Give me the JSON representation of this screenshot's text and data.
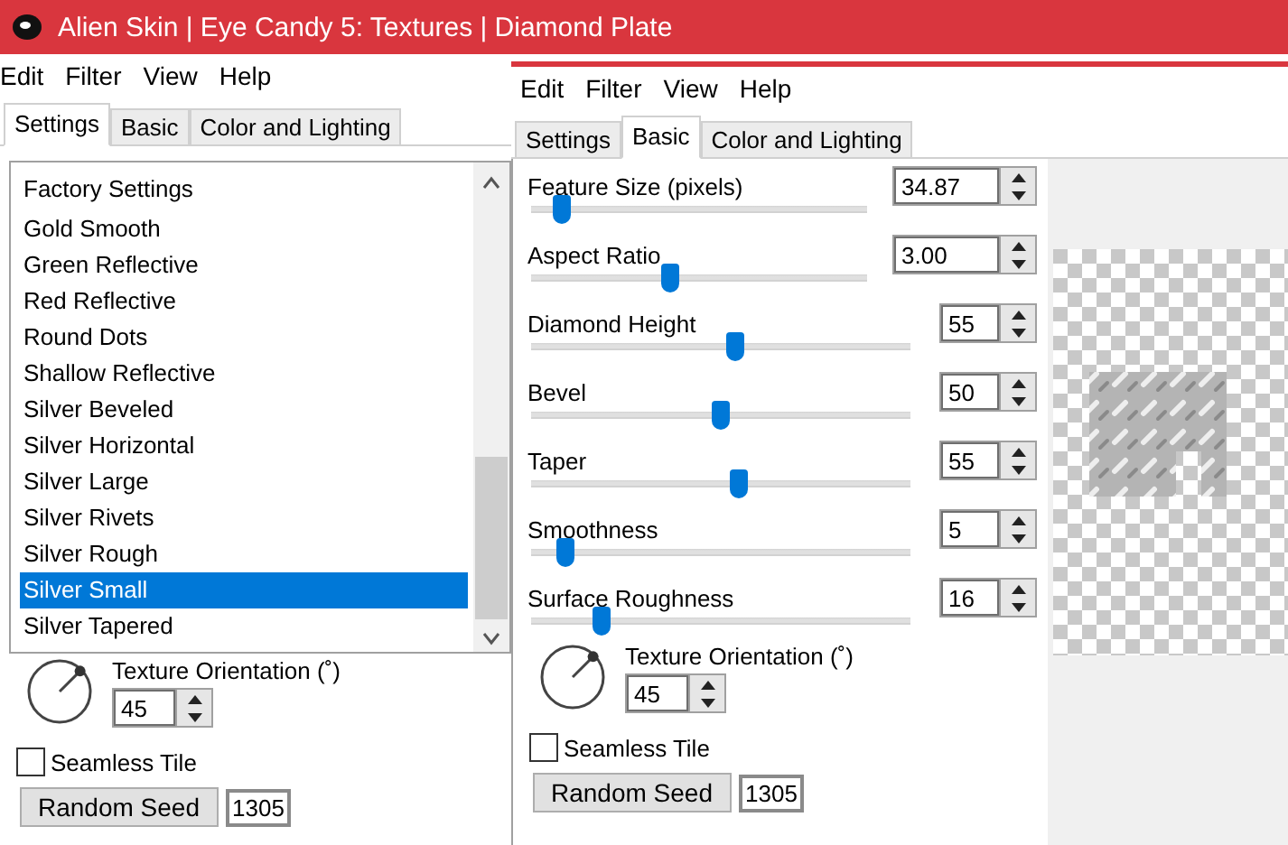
{
  "window": {
    "title": "Alien Skin | Eye Candy 5: Textures | Diamond Plate"
  },
  "left": {
    "menu": [
      "Edit",
      "Filter",
      "View",
      "Help"
    ],
    "tabs": [
      {
        "label": "Settings",
        "selected": true
      },
      {
        "label": "Basic",
        "selected": false
      },
      {
        "label": "Color and Lighting",
        "selected": false
      }
    ],
    "presets": [
      {
        "label": "Factory Settings",
        "selected": false,
        "kind": "header"
      },
      {
        "label": "Gold Smooth",
        "selected": false,
        "kind": "item"
      },
      {
        "label": "Green Reflective",
        "selected": false,
        "kind": "item"
      },
      {
        "label": "Red Reflective",
        "selected": false,
        "kind": "item"
      },
      {
        "label": "Round Dots",
        "selected": false,
        "kind": "item"
      },
      {
        "label": "Shallow Reflective",
        "selected": false,
        "kind": "item"
      },
      {
        "label": "Silver Beveled",
        "selected": false,
        "kind": "item"
      },
      {
        "label": "Silver Horizontal",
        "selected": false,
        "kind": "item"
      },
      {
        "label": "Silver Large",
        "selected": false,
        "kind": "item"
      },
      {
        "label": "Silver Rivets",
        "selected": false,
        "kind": "item"
      },
      {
        "label": "Silver Rough",
        "selected": false,
        "kind": "item"
      },
      {
        "label": "Silver Small",
        "selected": true,
        "kind": "item"
      },
      {
        "label": "Silver Tapered",
        "selected": false,
        "kind": "item"
      }
    ],
    "orientation": {
      "label": "Texture Orientation (˚)",
      "value": "45"
    },
    "seamless": {
      "label": "Seamless Tile",
      "checked": false
    },
    "seed": {
      "button": "Random Seed",
      "value": "1305"
    }
  },
  "right": {
    "menu": [
      "Edit",
      "Filter",
      "View",
      "Help"
    ],
    "tabs": [
      {
        "label": "Settings",
        "selected": false
      },
      {
        "label": "Basic",
        "selected": true
      },
      {
        "label": "Color and Lighting",
        "selected": false
      }
    ],
    "sliders": [
      {
        "label": "Feature Size (pixels)",
        "value": "34.87",
        "level": 0.07,
        "kind": "wide"
      },
      {
        "label": "Aspect Ratio",
        "value": "3.00",
        "level": 0.41,
        "kind": "wide"
      },
      {
        "label": "Diamond Height",
        "value": "55",
        "level": 0.54,
        "kind": "narrow"
      },
      {
        "label": "Bevel",
        "value": "50",
        "level": 0.5,
        "kind": "narrow"
      },
      {
        "label": "Taper",
        "value": "55",
        "level": 0.55,
        "kind": "narrow"
      },
      {
        "label": "Smoothness",
        "value": "5",
        "level": 0.07,
        "kind": "narrow"
      },
      {
        "label": "Surface Roughness",
        "value": "16",
        "level": 0.17,
        "kind": "narrow"
      }
    ],
    "orientation": {
      "label": "Texture Orientation (˚)",
      "value": "45"
    },
    "seamless": {
      "label": "Seamless Tile",
      "checked": false
    },
    "seed": {
      "button": "Random Seed",
      "value": "1305"
    }
  }
}
